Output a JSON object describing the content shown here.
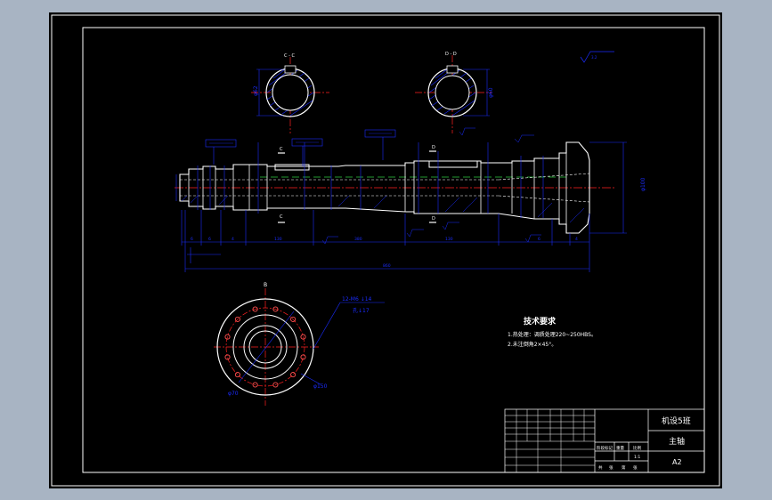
{
  "colors": {
    "background": "#a8b4c3",
    "paper": "#000000",
    "frame": "#ffffff",
    "outline": "#ffffff",
    "dimension": "#1a2cff",
    "hatch": "#1a2cff",
    "centerline": "#ff2020",
    "axis_dash": "#2ecc40",
    "accent": "#ff3030"
  },
  "sections": {
    "left_label": "C - C",
    "right_label": "D - D",
    "left_dim": "φ62",
    "right_dim": "φ60"
  },
  "shaft": {
    "marks_c": "C",
    "marks_d": "D",
    "bottom_dims": [
      "6",
      "6",
      "4",
      "130",
      "380",
      "130",
      "6",
      "4"
    ],
    "overall_length": "860",
    "right_dim": "φ100"
  },
  "flange_view": {
    "label_top": "B",
    "holes_note": "12-M6 ↓14",
    "holes_sub": "孔↓17",
    "dim_inner": "φ70",
    "dim_outer": "φ150"
  },
  "technical_requirements": {
    "title": "技术要求",
    "items": [
      "1.热处理：调质处理220~250HBS。",
      "2.未注倒角2×45°。"
    ]
  },
  "title_block": {
    "drawing_name": "机设5班",
    "part_name": "主轴",
    "sheet_size": "A2",
    "hdr_cells": [
      "阶段标记",
      "重量",
      "比例"
    ],
    "scale": "1:1",
    "sheet_row": [
      "共",
      "张",
      "第",
      "张"
    ]
  }
}
